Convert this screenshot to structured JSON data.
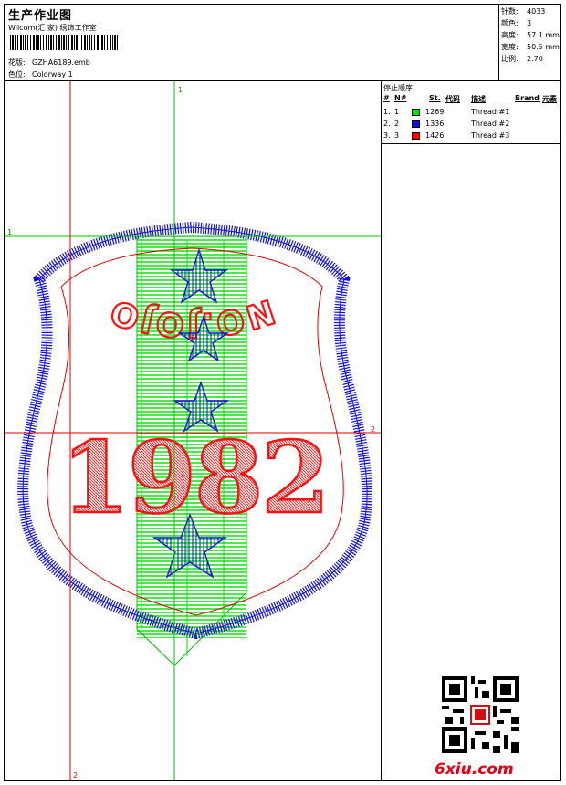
{
  "header": {
    "title": "生产作业图",
    "studio": "Wilcom(汇 家) 绣饰工作室",
    "design_label": "花版:",
    "design_file": "GZHA6189.emb",
    "colorway_label": "色位:",
    "colorway": "Colorway 1"
  },
  "stats": [
    {
      "label": "针数:",
      "value": "4033"
    },
    {
      "label": "颜色:",
      "value": "3"
    },
    {
      "label": "高度:",
      "value": "57.1 mm"
    },
    {
      "label": "宽度:",
      "value": "50.5 mm"
    },
    {
      "label": "比例:",
      "value": "2.70"
    }
  ],
  "stop_sequence": {
    "title": "停止顺序:",
    "columns": {
      "hash": "#",
      "n": "N#",
      "st": "St.",
      "code": "代码",
      "desc": "描述",
      "brand": "Brand",
      "element": "元素"
    },
    "rows": [
      {
        "idx": "1.",
        "n": "1",
        "code": "1269",
        "desc": "Thread #1",
        "color": "#00e000"
      },
      {
        "idx": "2.",
        "n": "2",
        "code": "1336",
        "desc": "Thread #2",
        "color": "#1010e0"
      },
      {
        "idx": "3.",
        "n": "3",
        "code": "1426",
        "desc": "Thread #3",
        "color": "#ff0000"
      }
    ]
  },
  "canvas": {
    "guide_labels": {
      "top_green": "1",
      "left_green": "1",
      "right_red": "2",
      "bottom_red": "2"
    },
    "patch_text": "NO.JOJO",
    "patch_number": "1982",
    "colors": {
      "outline": "#1010e0",
      "inner": "#e00000",
      "stripe": "#00e000",
      "guide_red": "#e00000",
      "guide_green": "#00c000"
    }
  },
  "brand": {
    "watermark": "6xiu.com"
  }
}
